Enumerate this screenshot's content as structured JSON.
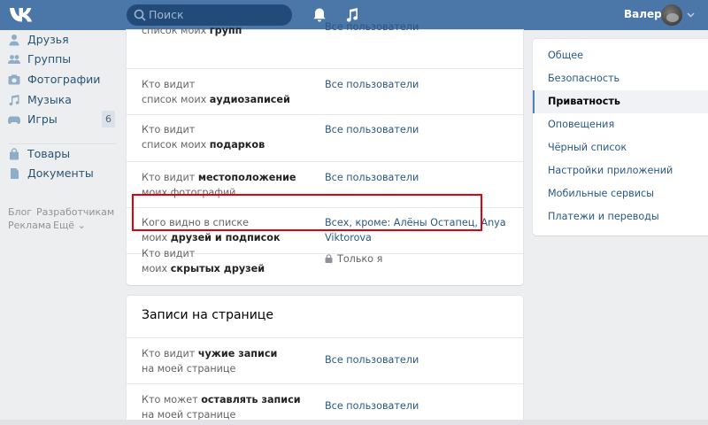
{
  "header": {
    "search_placeholder": "Поиск",
    "user_name": "Валера",
    "brand_color": "#4a76a8"
  },
  "left_nav": {
    "items": [
      {
        "label": "Друзья",
        "icon": "person-icon"
      },
      {
        "label": "Группы",
        "icon": "group-icon"
      },
      {
        "label": "Фотографии",
        "icon": "camera-icon"
      },
      {
        "label": "Музыка",
        "icon": "music-icon"
      },
      {
        "label": "Игры",
        "icon": "gamepad-icon",
        "count": "6"
      },
      {
        "label": "Товары",
        "icon": "bag-icon"
      },
      {
        "label": "Документы",
        "icon": "document-icon"
      }
    ],
    "footer": {
      "blog": "Блог",
      "developers": "Разработчикам",
      "ads": "Реклама",
      "more": "Ещё"
    }
  },
  "privacy_rows": [
    {
      "q1": "",
      "q2a": "список моих ",
      "q2b": "групп",
      "value": "Все пользователи"
    },
    {
      "q1": "Кто видит",
      "q2a": "список моих ",
      "q2b": "аудиозаписей",
      "value": "Все пользователи"
    },
    {
      "q1": "Кто видит",
      "q2a": "список моих ",
      "q2b": "подарков",
      "value": "Все пользователи"
    },
    {
      "q1a": "Кто видит ",
      "q1b": "местоположение",
      "q2a": "моих фотографий",
      "value": "Все пользователи"
    },
    {
      "q1": "Кого видно в списке",
      "q2a": "моих ",
      "q2b": "друзей и подписок",
      "value_line1": "Всех, кроме: Алёны Остапец, Anya",
      "value_line2": "Viktorova"
    },
    {
      "q1": "Кто видит",
      "q2a": "моих ",
      "q2b": "скрытых друзей",
      "value": "Только я",
      "value_icon": "lock-icon"
    }
  ],
  "wall_section": {
    "title": "Записи на странице",
    "rows": [
      {
        "q1a": "Кто видит ",
        "q1b": "чужие записи",
        "q2": "на моей странице",
        "value": "Все пользователи"
      },
      {
        "q1a": "Кто может ",
        "q1b": "оставлять записи",
        "q2": "на моей странице",
        "value": "Все пользователи"
      }
    ]
  },
  "right_menu": {
    "items": [
      "Общее",
      "Безопасность",
      "Приватность",
      "Оповещения",
      "Чёрный список",
      "Настройки приложений",
      "Мобильные сервисы",
      "Платежи и переводы"
    ],
    "active_index": 2
  },
  "colors": {
    "link": "#2a5885",
    "highlight_border": "#e3000f"
  }
}
